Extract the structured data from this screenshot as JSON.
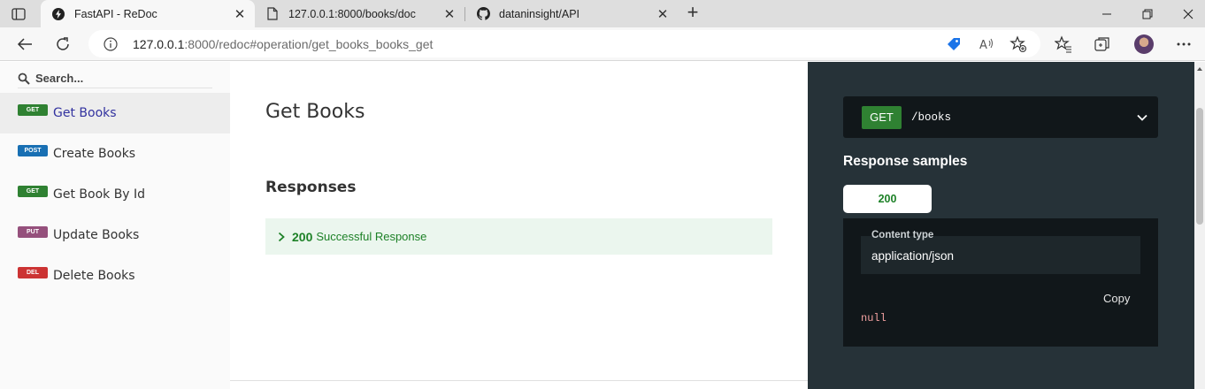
{
  "browser": {
    "tabs": [
      {
        "title": "FastAPI - ReDoc",
        "icon": "bolt-icon",
        "active": true
      },
      {
        "title": "127.0.0.1:8000/books/doc",
        "icon": "page-icon",
        "active": false
      },
      {
        "title": "dataninsight/API",
        "icon": "github-icon",
        "active": false
      }
    ],
    "new_tab_label": "+",
    "address": {
      "host": "127.0.0.1",
      "rest": ":8000/redoc#operation/get_books_books_get"
    }
  },
  "sidebar": {
    "search_placeholder": "Search...",
    "items": [
      {
        "method": "GET",
        "label": "Get Books",
        "active": true
      },
      {
        "method": "POST",
        "label": "Create Books",
        "active": false
      },
      {
        "method": "GET",
        "label": "Get Book By Id",
        "active": false
      },
      {
        "method": "PUT",
        "label": "Update Books",
        "active": false
      },
      {
        "method": "DEL",
        "label": "Delete Books",
        "active": false
      }
    ]
  },
  "operation": {
    "title": "Get Books",
    "responses_heading": "Responses",
    "responses": [
      {
        "code": "200",
        "description": "Successful Response"
      }
    ]
  },
  "right_panel": {
    "method": "GET",
    "path": "/books",
    "samples_heading": "Response samples",
    "status_tab": "200",
    "content_type_label": "Content type",
    "content_type_value": "application/json",
    "copy_label": "Copy",
    "sample_value": "null"
  },
  "colors": {
    "get": "#2f8132",
    "post": "#186fb3",
    "put": "#95507c",
    "delete": "#cc3333",
    "right_panel_bg": "#263238",
    "active_menu_text": "#32329f"
  }
}
